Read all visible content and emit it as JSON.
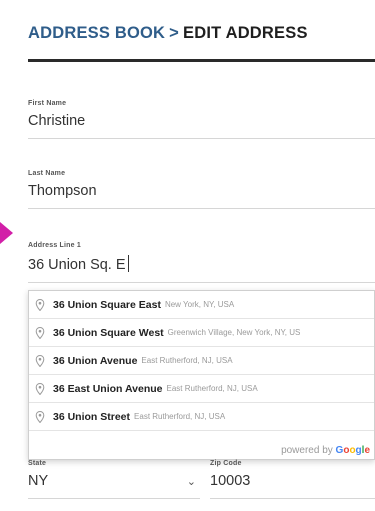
{
  "breadcrumb": {
    "parent": "ADDRESS BOOK",
    "separator": ">",
    "current": "EDIT ADDRESS"
  },
  "form": {
    "first_name": {
      "label": "First Name",
      "value": "Christine"
    },
    "last_name": {
      "label": "Last Name",
      "value": "Thompson"
    },
    "address_line_1": {
      "label": "Address Line 1",
      "value": "36 Union Sq. E"
    },
    "state": {
      "label": "State",
      "value": "NY"
    },
    "zip": {
      "label": "Zip Code",
      "value": "10003"
    }
  },
  "autocomplete": {
    "suggestions": [
      {
        "main": "36 Union Square East",
        "secondary": "New York, NY, USA"
      },
      {
        "main": "36 Union Square West",
        "secondary": "Greenwich Village, New York, NY, US"
      },
      {
        "main": "36 Union Avenue",
        "secondary": "East Rutherford, NJ, USA"
      },
      {
        "main": "36 East Union Avenue",
        "secondary": "East Rutherford, NJ, USA"
      },
      {
        "main": "36 Union Street",
        "secondary": "East Rutherford, NJ, USA"
      }
    ],
    "powered_by": "powered by",
    "brand_letters": [
      "G",
      "o",
      "o",
      "g",
      "l",
      "e"
    ]
  },
  "icons": {
    "suggestion_icon": "map-pin-icon",
    "state_dropdown": "chevron-down-icon",
    "pointer": "arrow-pointer-icon"
  },
  "colors": {
    "breadcrumb_link": "#2f5d8a",
    "pointer_arrow": "#d21fa8"
  }
}
